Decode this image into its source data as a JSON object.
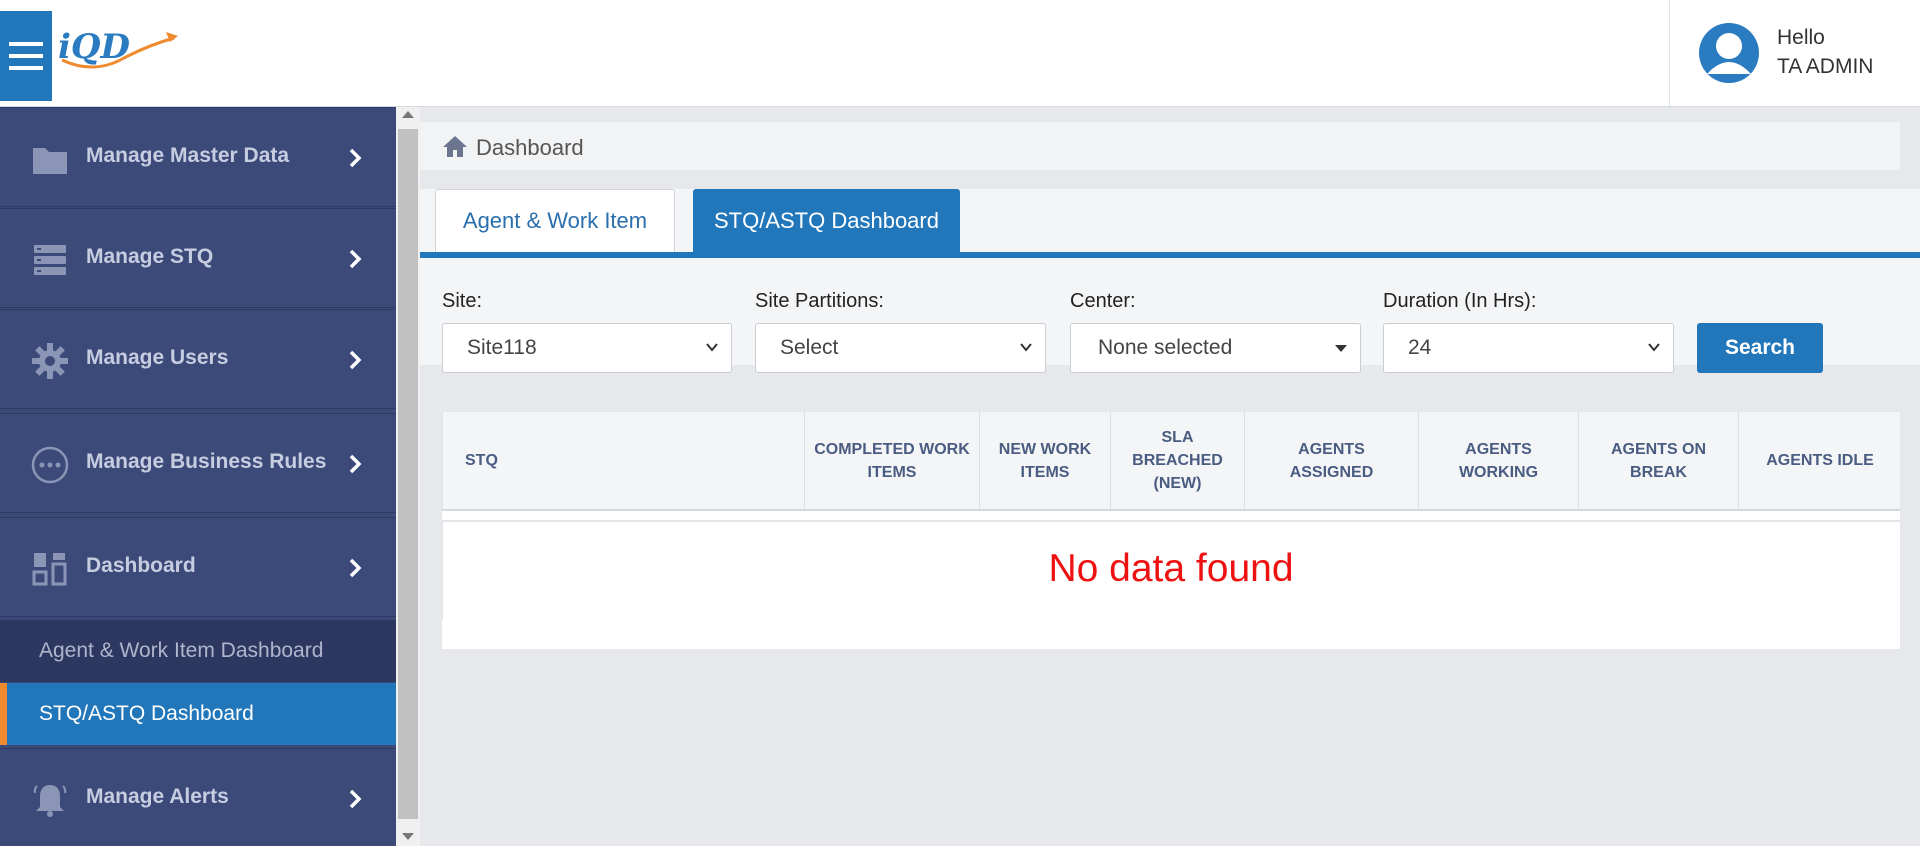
{
  "header": {
    "logo_text": "iQD",
    "greeting": "Hello",
    "user_name": "TA ADMIN"
  },
  "sidebar": {
    "items": [
      {
        "label": "Manage Master Data",
        "icon": "folder-icon"
      },
      {
        "label": "Manage STQ",
        "icon": "server-icon"
      },
      {
        "label": "Manage Users",
        "icon": "gear-icon"
      },
      {
        "label": "Manage Business Rules",
        "icon": "more-circle-icon"
      },
      {
        "label": "Dashboard",
        "icon": "grid-icon"
      },
      {
        "label": "Manage Alerts",
        "icon": "bell-icon"
      }
    ],
    "sub_items": [
      {
        "label": "Agent & Work Item Dashboard"
      },
      {
        "label": "STQ/ASTQ Dashboard",
        "active": true
      }
    ]
  },
  "breadcrumb": {
    "label": "Dashboard"
  },
  "tabs": [
    {
      "label": "Agent & Work Item"
    },
    {
      "label": "STQ/ASTQ Dashboard",
      "active": true
    }
  ],
  "filters": {
    "site": {
      "label": "Site:",
      "value": "Site118"
    },
    "partitions": {
      "label": "Site Partitions:",
      "value": "Select"
    },
    "center": {
      "label": "Center:",
      "value": "None selected"
    },
    "duration": {
      "label": "Duration (In Hrs):",
      "value": "24"
    },
    "search_label": "Search"
  },
  "table": {
    "columns": [
      "STQ",
      "COMPLETED WORK ITEMS",
      "NEW WORK ITEMS",
      "SLA BREACHED (NEW)",
      "AGENTS ASSIGNED",
      "AGENTS WORKING",
      "AGENTS ON BREAK",
      "AGENTS IDLE"
    ],
    "empty_message": "No data found"
  },
  "colors": {
    "primary": "#2277bb",
    "sidebar": "#3c4a7a",
    "accent": "#f08a2e",
    "error": "#ee1111"
  }
}
